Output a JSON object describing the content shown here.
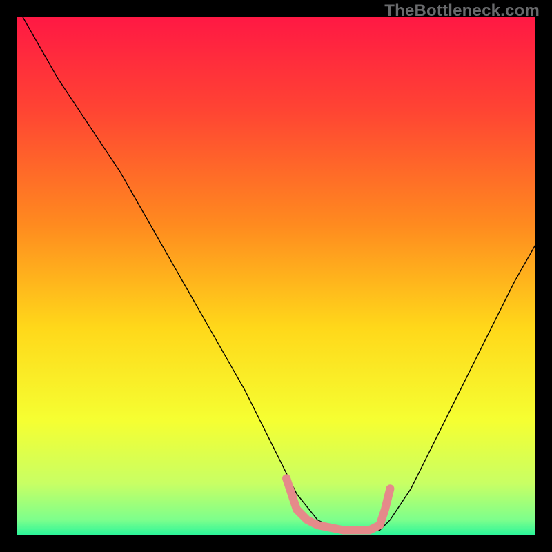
{
  "watermark": "TheBottleneck.com",
  "chart_data": {
    "type": "line",
    "title": "",
    "xlabel": "",
    "ylabel": "",
    "xlim": [
      0,
      100
    ],
    "ylim": [
      0,
      100
    ],
    "background_gradient": {
      "type": "vertical",
      "stops": [
        {
          "offset": 0.0,
          "color": "#ff1844"
        },
        {
          "offset": 0.18,
          "color": "#ff4433"
        },
        {
          "offset": 0.4,
          "color": "#ff8a1f"
        },
        {
          "offset": 0.6,
          "color": "#ffd81a"
        },
        {
          "offset": 0.78,
          "color": "#f5ff32"
        },
        {
          "offset": 0.9,
          "color": "#c8ff64"
        },
        {
          "offset": 0.97,
          "color": "#7dff8c"
        },
        {
          "offset": 1.0,
          "color": "#28f59a"
        }
      ]
    },
    "series": [
      {
        "name": "curve",
        "color": "#000000",
        "stroke_width": 1.4,
        "x": [
          0,
          4,
          8,
          12,
          16,
          20,
          24,
          28,
          32,
          36,
          40,
          44,
          48,
          52,
          54,
          58,
          62,
          66,
          70,
          72,
          76,
          80,
          84,
          88,
          92,
          96,
          100
        ],
        "y": [
          102,
          95,
          88,
          82,
          76,
          70,
          63,
          56,
          49,
          42,
          35,
          28,
          20,
          12,
          8,
          3,
          1,
          1,
          1,
          3,
          9,
          17,
          25,
          33,
          41,
          49,
          56
        ]
      }
    ],
    "highlight": {
      "name": "trough-marker",
      "color": "#e58a8a",
      "stroke_width": 12,
      "x": [
        52,
        54,
        56,
        58,
        63,
        68,
        70,
        71,
        72
      ],
      "y": [
        11,
        5,
        3,
        2,
        1,
        1,
        2,
        5,
        9
      ]
    }
  }
}
